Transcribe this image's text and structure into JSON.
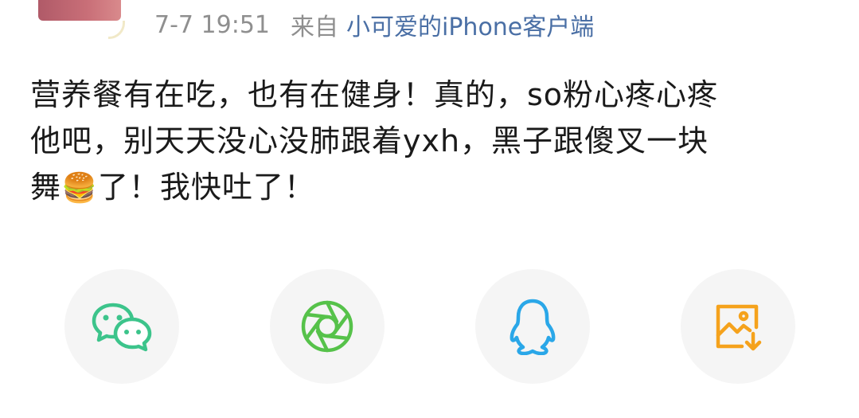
{
  "post": {
    "meta": {
      "time": "7-7 19:51",
      "from_label": "来自",
      "source": "小可爱的iPhone客户端"
    },
    "text_lines": [
      "营养餐有在吃，也有在健身！真的，so粉心疼心疼",
      "他吧，别天天没心没肺跟着yxh，黑子跟傻叉一块",
      "舞"
    ],
    "emoji": "🍔",
    "text_tail": "了！我快吐了！"
  },
  "share": {
    "buttons": [
      {
        "name": "wechat",
        "icon": "wechat-icon",
        "color": "#3cc48b"
      },
      {
        "name": "moments",
        "icon": "aperture-icon",
        "color": "#56c24a"
      },
      {
        "name": "qq",
        "icon": "penguin-icon",
        "color": "#2aa7e8"
      },
      {
        "name": "save-image",
        "icon": "image-download-icon",
        "color": "#f5a21c"
      }
    ]
  }
}
